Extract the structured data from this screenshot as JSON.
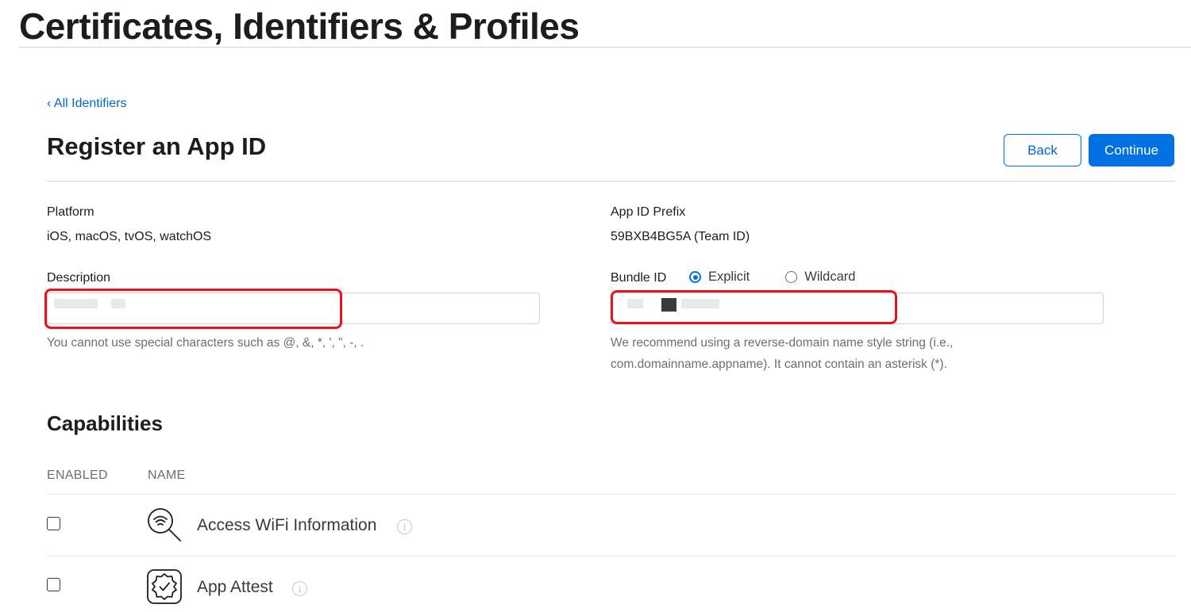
{
  "header": {
    "title": "Certificates, Identifiers & Profiles"
  },
  "nav": {
    "back_link": "‹ All Identifiers"
  },
  "section": {
    "title": "Register an App ID",
    "back_button": "Back",
    "continue_button": "Continue"
  },
  "platform": {
    "label": "Platform",
    "value": "iOS, macOS, tvOS, watchOS"
  },
  "prefix": {
    "label": "App ID Prefix",
    "value": "59BXB4BG5A (Team ID)"
  },
  "description": {
    "label": "Description",
    "value": "",
    "hint": "You cannot use special characters such as @, &, *, ', \", -, ."
  },
  "bundle": {
    "label": "Bundle ID",
    "options": [
      "Explicit",
      "Wildcard"
    ],
    "selected": "Explicit",
    "value": "",
    "hint_line1": "We recommend using a reverse-domain name style string (i.e.,",
    "hint_line2": "com.domainname.appname). It cannot contain an asterisk (*)."
  },
  "capabilities": {
    "title": "Capabilities",
    "columns": [
      "ENABLED",
      "NAME"
    ],
    "rows": [
      {
        "name": "Access WiFi Information",
        "enabled": false,
        "icon": "wifi-search-icon"
      },
      {
        "name": "App Attest",
        "enabled": false,
        "icon": "badge-check-icon"
      }
    ]
  },
  "colors": {
    "accent": "#0071e3",
    "link": "#0066cc",
    "highlight": "#e8121c"
  }
}
